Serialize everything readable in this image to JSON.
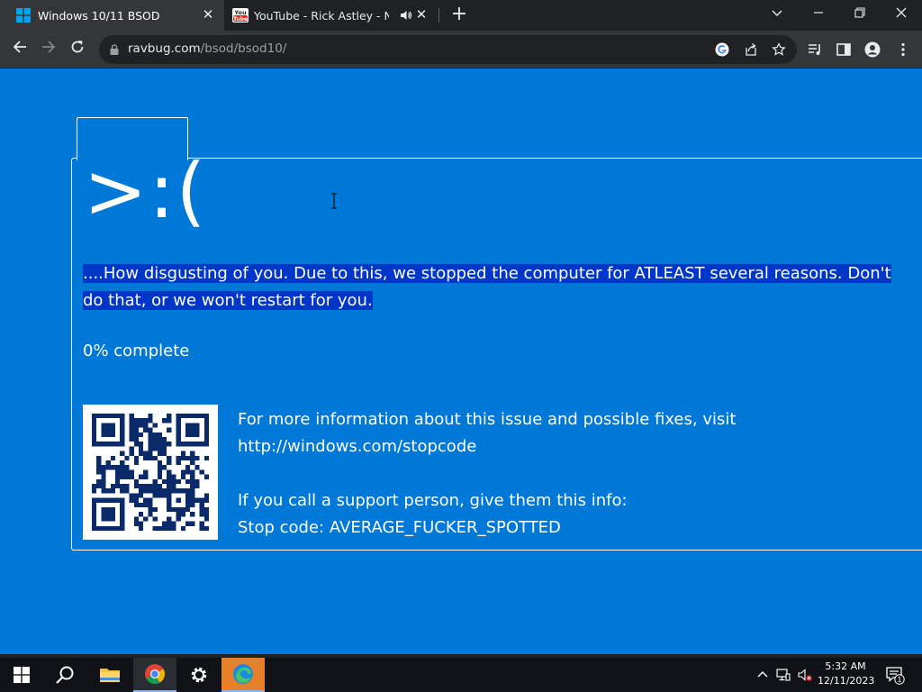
{
  "browser": {
    "tabs": [
      {
        "title": "Windows 10/11 BSOD",
        "active": true
      },
      {
        "title": "YouTube - Rick Astley - Never",
        "active": false,
        "audio": true
      }
    ],
    "url_domain": "ravbug.com",
    "url_path": "/bsod/bsod10/"
  },
  "bsod": {
    "face": ">:(",
    "message": "....How disgusting of you. Due to this, we stopped the computer for ATLEAST several reasons. Don't do that, or we won't restart for you.",
    "progress": "0% complete",
    "info_line1": "For more information about this issue and possible fixes, visit",
    "info_link": "http://windows.com/stopcode",
    "support_line": "If you call a support person, give them this info:",
    "stop_code": "Stop code: AVERAGE_FUCKER_SPOTTED"
  },
  "taskbar": {
    "time": "5:32 AM",
    "date": "12/11/2023",
    "notification_count": "1"
  },
  "colors": {
    "bsod_blue": "#0078d7",
    "selection": "#0037c8",
    "chrome_dark": "#202124",
    "chrome_toolbar": "#35363a"
  }
}
